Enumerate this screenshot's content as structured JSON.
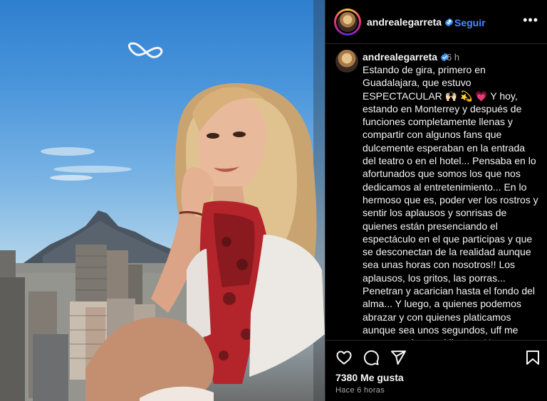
{
  "post": {
    "username": "andrealegarreta",
    "follow_label": "Seguir",
    "separator": "•",
    "more_label": "•••",
    "time_ago": "6 h",
    "caption": "Estando de gira, primero en Guadalajara, que estuvo ESPECTACULAR 🙌🏻 💫 💗 Y hoy, estando en Monterrey y después de funciones completamente llenas y compartir con algunos fans que dulcemente esperaban en la entrada del teatro o en el hotel... Pensaba en lo afortunados que somos los que nos dedicamos al entretenimiento... En lo hermoso que es, poder ver los rostros y sentir los aplausos y sonrisas de quienes están presenciando el espectáculo en el que participas y que se desconectan de la realidad aunque sea unas horas con nosotros!! Los aplausos, los gritos, las porras... Penetran y acarician hasta el fondo del alma... Y luego, a quienes podemos abrazar y con quienes platicamos aunque sea unos segundos, uff me conmuevo hasta el llanto... Hacen que sienta que vale la pena la carrera que elegí!! Gracias a quienes se acercan a dar amor... Gracias por sus dulces palabras",
    "likes": "7380 Me gusta",
    "timestamp": "Hace 6 horas"
  },
  "icons": {
    "like": "heart-icon",
    "comment": "comment-icon",
    "share": "share-icon",
    "save": "bookmark-icon",
    "verified": "verified-badge-icon"
  },
  "colors": {
    "accent": "#4a8dff",
    "verified": "#3897f0",
    "background": "#000000",
    "muted": "#a8a8a8"
  }
}
